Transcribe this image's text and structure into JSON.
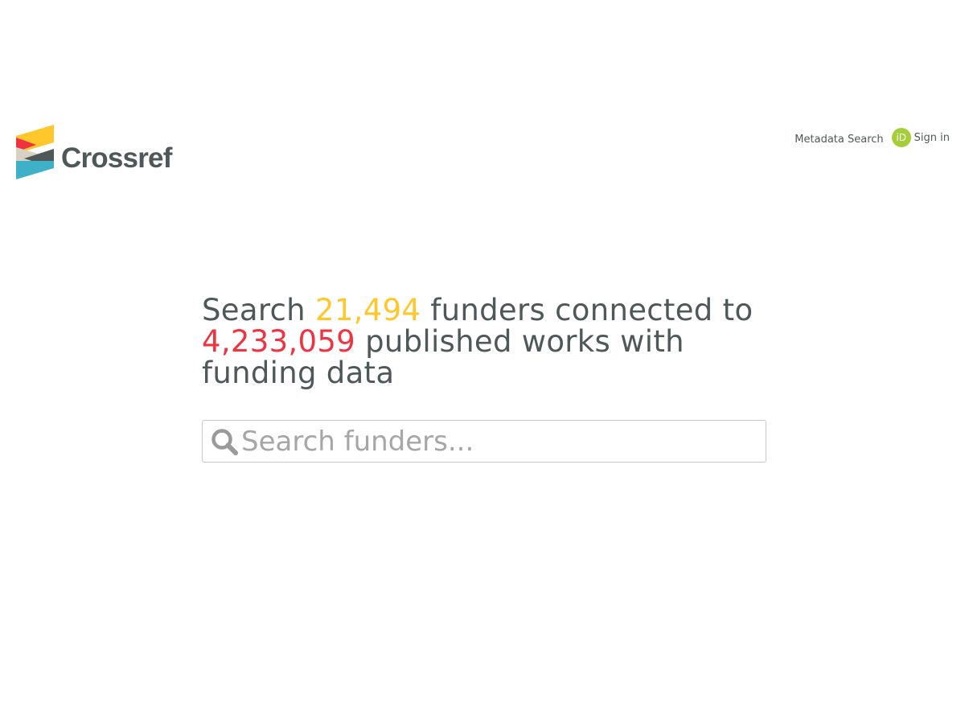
{
  "brand": {
    "name": "Crossref",
    "colors": {
      "yellow": "#ffc72c",
      "red": "#ef3340",
      "teal": "#3eb1c8",
      "gray": "#4f5858",
      "light": "#d8d2c4"
    }
  },
  "nav": {
    "metadata_search": "Metadata Search",
    "orcid_icon": "iD",
    "sign_in": "Sign in"
  },
  "hero": {
    "prefix": "Search ",
    "funders_count": "21,494",
    "middle": " funders connected to ",
    "works_count": "4,233,059",
    "suffix": " published works with funding data"
  },
  "search": {
    "placeholder": "Search funders...",
    "value": "",
    "icon": "search-icon"
  }
}
